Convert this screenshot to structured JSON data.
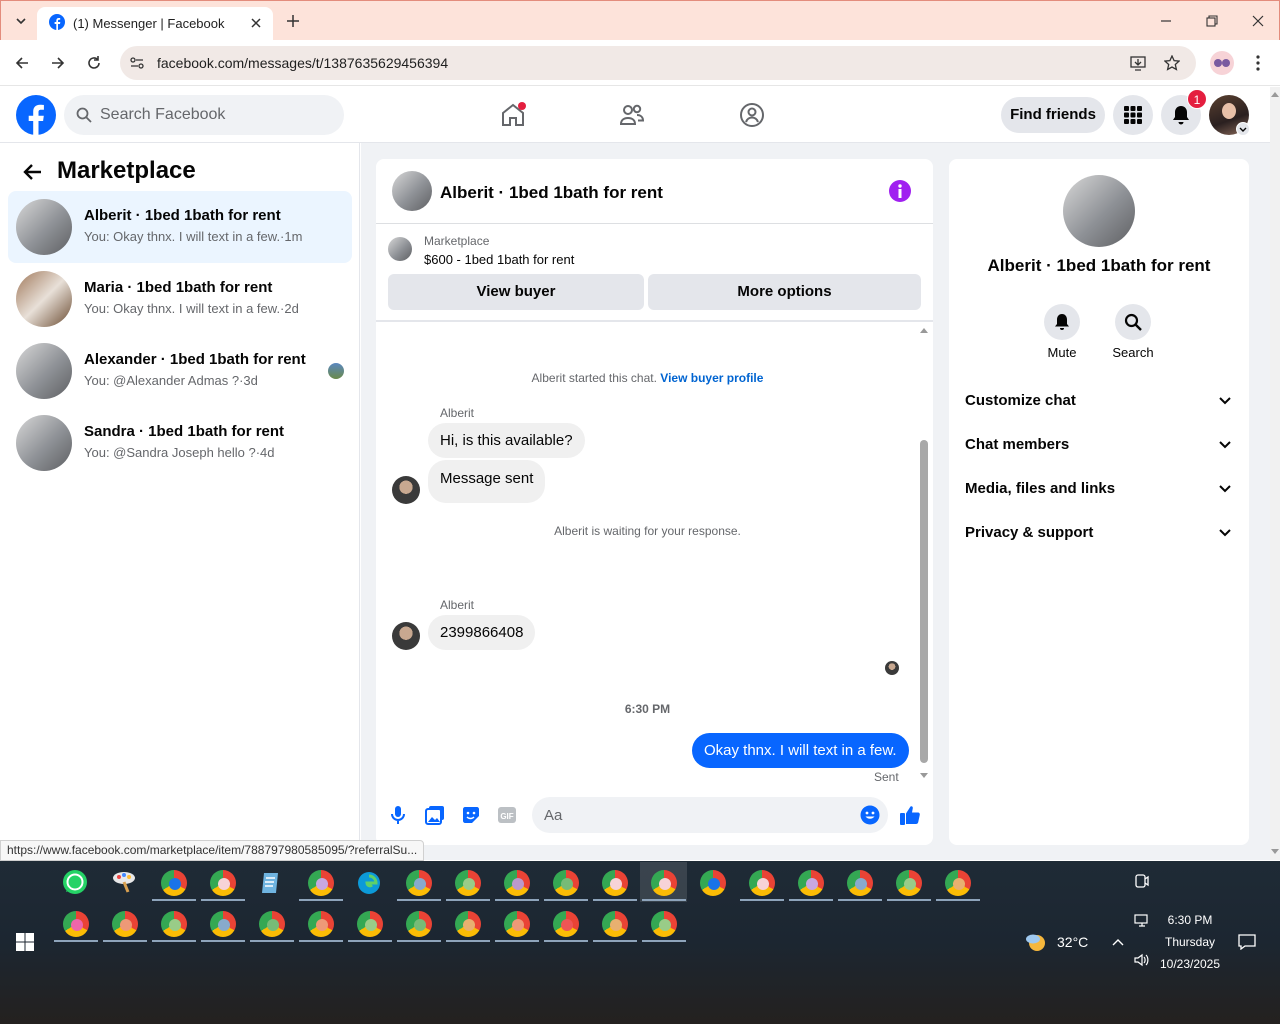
{
  "browser": {
    "tab_title": "(1) Messenger | Facebook",
    "url": "facebook.com/messages/t/1387635629456394",
    "status_url": "https://www.facebook.com/marketplace/item/788797980585095/?referralSu..."
  },
  "fb_header": {
    "search_placeholder": "Search Facebook",
    "find_friends": "Find friends",
    "notif_count": "1"
  },
  "left": {
    "title": "Marketplace",
    "conversations": [
      {
        "name": "Alberit · 1bed 1bath for rent",
        "snippet": "You: Okay thnx. I will text in a few.·1m"
      },
      {
        "name": "Maria · 1bed 1bath for rent",
        "snippet": "You: Okay thnx. I will text in a few.·2d"
      },
      {
        "name": "Alexander · 1bed 1bath for rent",
        "snippet": "You: @Alexander Admas ?·3d"
      },
      {
        "name": "Sandra · 1bed 1bath for rent",
        "snippet": "You: @Sandra Joseph hello ?·4d"
      }
    ]
  },
  "chat": {
    "title": "Alberit · 1bed 1bath for rent",
    "listing_label": "Marketplace",
    "listing_price": "$600 - 1bed 1bath for rent",
    "view_buyer": "View buyer",
    "more_options": "More options",
    "started_text": "Alberit started this chat.",
    "view_profile": "View buyer profile",
    "sender1": "Alberit",
    "msg1": "Hi, is this available?",
    "msg2": "Message sent",
    "waiting": "Alberit is waiting for your response.",
    "sender2": "Alberit",
    "msg3": "2399866408",
    "time": "6:30 PM",
    "my_msg": "Okay thnx. I will text in a few.",
    "sent": "Sent",
    "composer_placeholder": "Aa"
  },
  "info": {
    "title": "Alberit · 1bed 1bath for rent",
    "mute": "Mute",
    "search": "Search",
    "sections": [
      "Customize chat",
      "Chat members",
      "Media, files and links",
      "Privacy & support"
    ]
  },
  "taskbar": {
    "weather": "32°C",
    "time": "6:30 PM",
    "day": "Thursday",
    "date": "10/23/2025"
  },
  "colors": {
    "fb_blue": "#0866ff",
    "info_purple": "#a020f0",
    "notif_red": "#e41e3f"
  }
}
